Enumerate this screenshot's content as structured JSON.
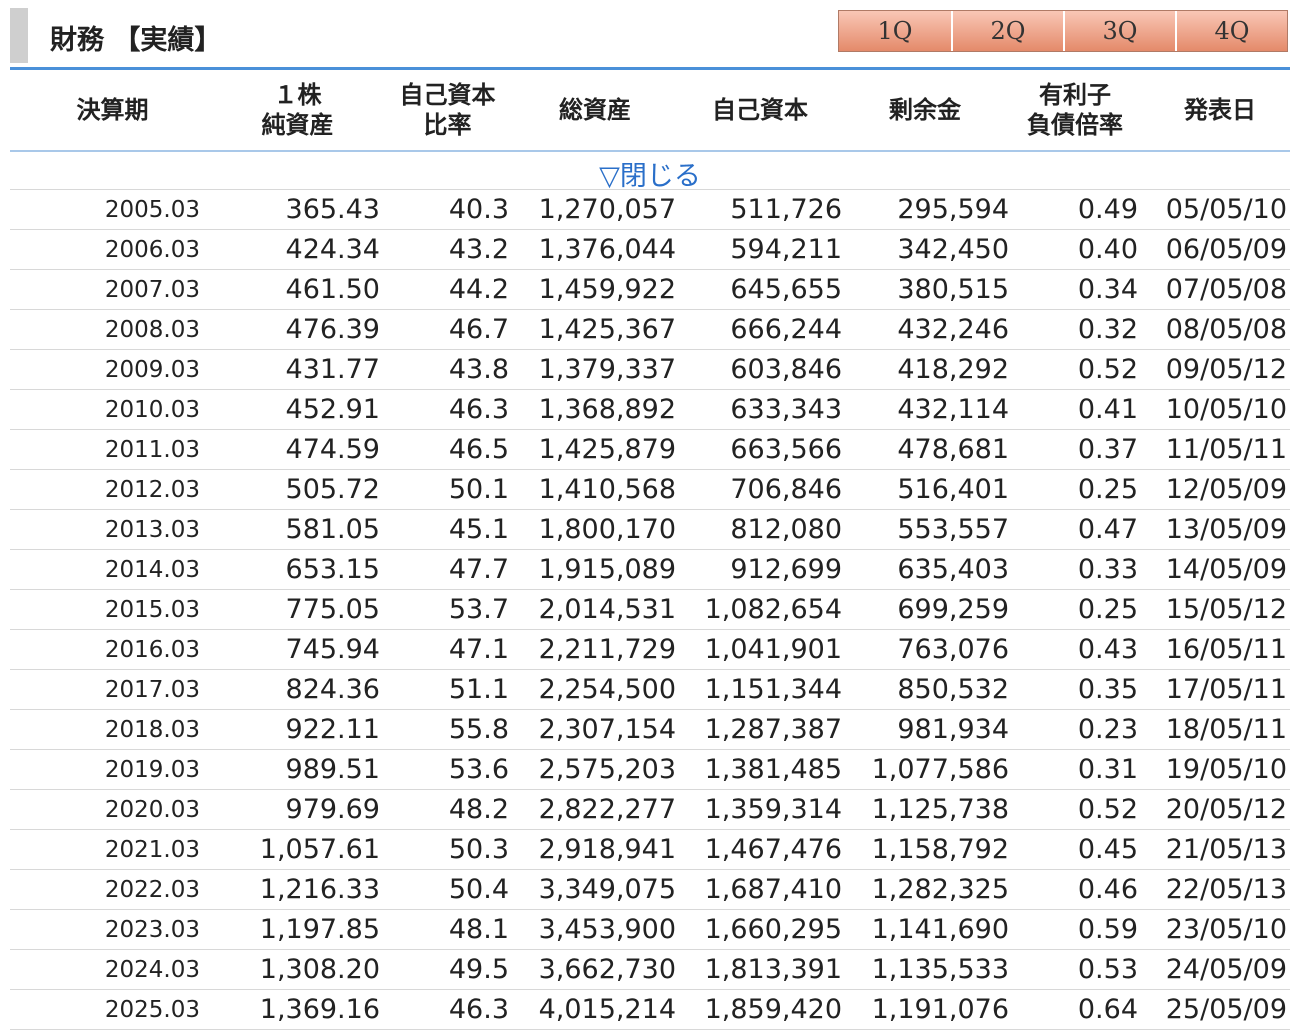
{
  "section": {
    "title": "財務 【実績】"
  },
  "quarter_tabs": [
    "1Q",
    "2Q",
    "3Q",
    "4Q"
  ],
  "table": {
    "columns": [
      "決算期",
      "１株\n純資産",
      "自己資本\n比率",
      "総資産",
      "自己資本",
      "剰余金",
      "有利子\n負債倍率",
      "発表日"
    ],
    "toggle_label": "▽閉じる",
    "rows": [
      [
        "2005.03",
        "365.43",
        "40.3",
        "1,270,057",
        "511,726",
        "295,594",
        "0.49",
        "05/05/10"
      ],
      [
        "2006.03",
        "424.34",
        "43.2",
        "1,376,044",
        "594,211",
        "342,450",
        "0.40",
        "06/05/09"
      ],
      [
        "2007.03",
        "461.50",
        "44.2",
        "1,459,922",
        "645,655",
        "380,515",
        "0.34",
        "07/05/08"
      ],
      [
        "2008.03",
        "476.39",
        "46.7",
        "1,425,367",
        "666,244",
        "432,246",
        "0.32",
        "08/05/08"
      ],
      [
        "2009.03",
        "431.77",
        "43.8",
        "1,379,337",
        "603,846",
        "418,292",
        "0.52",
        "09/05/12"
      ],
      [
        "2010.03",
        "452.91",
        "46.3",
        "1,368,892",
        "633,343",
        "432,114",
        "0.41",
        "10/05/10"
      ],
      [
        "2011.03",
        "474.59",
        "46.5",
        "1,425,879",
        "663,566",
        "478,681",
        "0.37",
        "11/05/11"
      ],
      [
        "2012.03",
        "505.72",
        "50.1",
        "1,410,568",
        "706,846",
        "516,401",
        "0.25",
        "12/05/09"
      ],
      [
        "2013.03",
        "581.05",
        "45.1",
        "1,800,170",
        "812,080",
        "553,557",
        "0.47",
        "13/05/09"
      ],
      [
        "2014.03",
        "653.15",
        "47.7",
        "1,915,089",
        "912,699",
        "635,403",
        "0.33",
        "14/05/09"
      ],
      [
        "2015.03",
        "775.05",
        "53.7",
        "2,014,531",
        "1,082,654",
        "699,259",
        "0.25",
        "15/05/12"
      ],
      [
        "2016.03",
        "745.94",
        "47.1",
        "2,211,729",
        "1,041,901",
        "763,076",
        "0.43",
        "16/05/11"
      ],
      [
        "2017.03",
        "824.36",
        "51.1",
        "2,254,500",
        "1,151,344",
        "850,532",
        "0.35",
        "17/05/11"
      ],
      [
        "2018.03",
        "922.11",
        "55.8",
        "2,307,154",
        "1,287,387",
        "981,934",
        "0.23",
        "18/05/11"
      ],
      [
        "2019.03",
        "989.51",
        "53.6",
        "2,575,203",
        "1,381,485",
        "1,077,586",
        "0.31",
        "19/05/10"
      ],
      [
        "2020.03",
        "979.69",
        "48.2",
        "2,822,277",
        "1,359,314",
        "1,125,738",
        "0.52",
        "20/05/12"
      ],
      [
        "2021.03",
        "1,057.61",
        "50.3",
        "2,918,941",
        "1,467,476",
        "1,158,792",
        "0.45",
        "21/05/13"
      ],
      [
        "2022.03",
        "1,216.33",
        "50.4",
        "3,349,075",
        "1,687,410",
        "1,282,325",
        "0.46",
        "22/05/13"
      ],
      [
        "2023.03",
        "1,197.85",
        "48.1",
        "3,453,900",
        "1,660,295",
        "1,141,690",
        "0.59",
        "23/05/10"
      ],
      [
        "2024.03",
        "1,308.20",
        "49.5",
        "3,662,730",
        "1,813,391",
        "1,135,533",
        "0.53",
        "24/05/09"
      ],
      [
        "2025.03",
        "1,369.16",
        "46.3",
        "4,015,214",
        "1,859,420",
        "1,191,076",
        "0.64",
        "25/05/09"
      ]
    ]
  }
}
